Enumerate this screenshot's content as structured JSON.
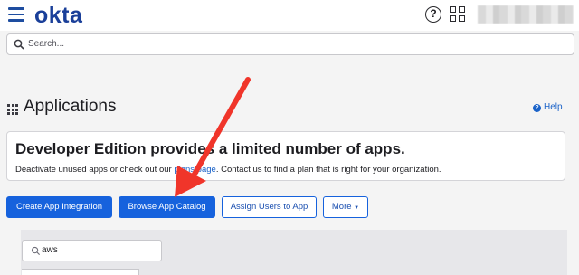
{
  "header": {
    "logo_text": "okta",
    "menu_icon": "hamburger-menu-icon",
    "help_glyph": "?",
    "grid_icon": "apps-grid-icon",
    "brand_color": "#1a3f99"
  },
  "search": {
    "placeholder": "Search..."
  },
  "page": {
    "title": "Applications",
    "title_icon": "apps-grid-icon",
    "help_label": "Help"
  },
  "notice": {
    "heading": "Developer Edition provides a limited number of apps.",
    "text_before": "Deactivate unused apps or check out our ",
    "link": "plans page",
    "text_after": ". Contact us to find a plan that is right for your organization."
  },
  "actions": {
    "create_label": "Create App Integration",
    "browse_label": "Browse App Catalog",
    "assign_label": "Assign Users to App",
    "more_label": "More",
    "more_caret": "▼",
    "primary_color": "#1662dd"
  },
  "filter": {
    "value": "aws"
  },
  "annotation": {
    "arrow_color": "#f0352a"
  }
}
